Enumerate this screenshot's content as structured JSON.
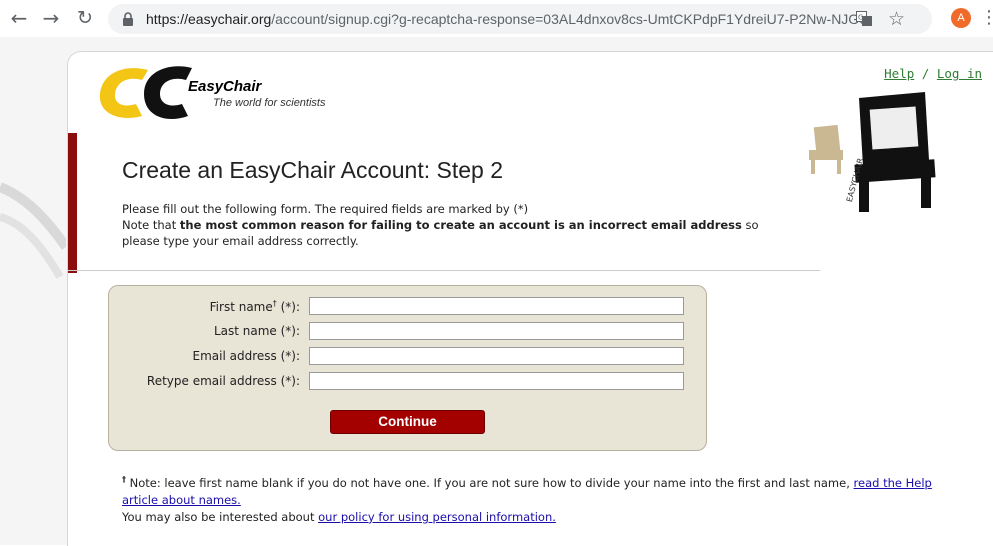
{
  "browser": {
    "url_host": "https://easychair.org",
    "url_path": "/account/signup.cgi?g-recaptcha-response=03AL4dnxov8cs-UmtCKPdpF1YdreiU7-P2Nw-NJGez...",
    "avatar_letter": "A"
  },
  "header": {
    "logo_title": "EasyChair",
    "logo_subtitle": "The world for scientists",
    "help_link": "Help",
    "separator": "/",
    "login_link": "Log in"
  },
  "main": {
    "title": "Create an EasyChair Account: Step 2",
    "intro_line1": "Please fill out the following form. The required fields are marked by (*)",
    "intro_note_prefix": "Note that ",
    "intro_note_bold": "the most common reason for failing to create an account is an incorrect email address",
    "intro_note_suffix": " so please type your email address correctly."
  },
  "form": {
    "first_name_label": "First name",
    "first_name_marker": "†",
    "first_name_required": " (*):",
    "last_name_label": "Last name (*):",
    "email_label": "Email address (*):",
    "retype_email_label": "Retype email address (*):",
    "first_name_value": "",
    "last_name_value": "",
    "email_value": "",
    "retype_email_value": "",
    "continue_label": "Continue"
  },
  "footnote": {
    "marker": "†",
    "text": " Note: leave first name blank if you do not have one. If you are not sure how to divide your name into the first and last name, ",
    "help_link": "read the Help article about names.",
    "policy_prefix": "You may also be interested about ",
    "policy_link": "our policy for using personal information."
  },
  "colors": {
    "brand_red": "#a30000",
    "link_green": "#2e7d32",
    "form_bg": "#e8e4d6"
  }
}
